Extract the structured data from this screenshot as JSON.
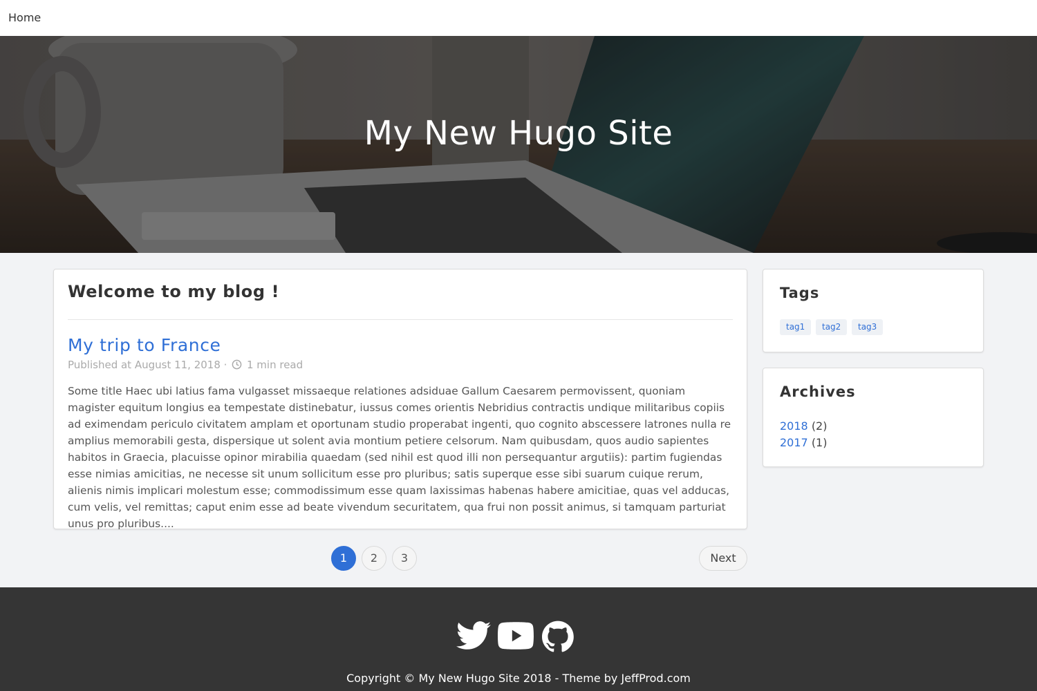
{
  "nav": {
    "home_label": "Home"
  },
  "hero": {
    "title": "My New Hugo Site"
  },
  "main": {
    "heading": "Welcome to my blog !",
    "post": {
      "title": "My trip to France",
      "published": "Published at August 11, 2018 ·",
      "read_time": "1 min read",
      "excerpt": "Some title Haec ubi latius fama vulgasset missaeque relationes adsiduae Gallum Caesarem permovissent, quoniam magister equitum longius ea tempestate distinebatur, iussus comes orientis Nebridius contractis undique militaribus copiis ad eximendam periculo civitatem amplam et oportunam studio properabat ingenti, quo cognito abscessere latrones nulla re amplius memorabili gesta, dispersique ut solent avia montium petiere celsorum. Nam quibusdam, quos audio sapientes habitos in Graecia, placuisse opinor mirabilia quaedam (sed nihil est quod illi non persequantur argutiis): partim fugiendas esse nimias amicitias, ne necesse sit unum sollicitum esse pro pluribus; satis superque esse sibi suarum cuique rerum, alienis nimis implicari molestum esse; commodissimum esse quam laxissimas habenas habere amicitiae, quas vel adducas, cum velis, vel remittas; caput enim esse ad beate vivendum securitatem, qua frui non possit animus, si tamquam parturiat unus pro pluribus...."
    }
  },
  "pagination": {
    "pages": [
      "1",
      "2",
      "3"
    ],
    "active": "1",
    "next_label": "Next"
  },
  "sidebar": {
    "tags_title": "Tags",
    "tags": [
      "tag1",
      "tag2",
      "tag3"
    ],
    "archives_title": "Archives",
    "archives": [
      {
        "year": "2018",
        "count": "(2)"
      },
      {
        "year": "2017",
        "count": "(1)"
      }
    ]
  },
  "footer": {
    "icons": [
      "twitter-icon",
      "youtube-icon",
      "github-icon"
    ],
    "copyright": "Copyright © My New Hugo Site 2018 - Theme by JeffProd.com"
  },
  "colors": {
    "accent": "#2f6fd6",
    "footer_bg": "#353535",
    "page_bg": "#f2f3f5"
  }
}
